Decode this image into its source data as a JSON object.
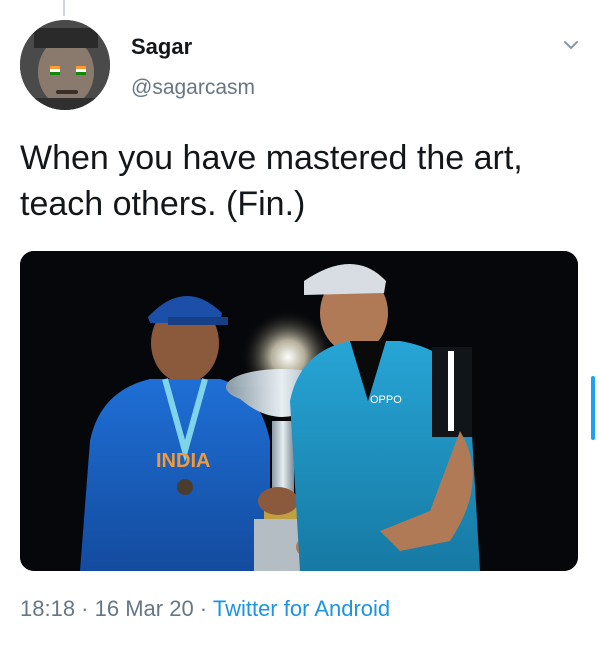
{
  "tweet": {
    "author_name": "Sagar",
    "author_handle": "@sagarcasm",
    "text_line1": "When you have mastered the art,",
    "text_line2": "teach others. (Fin.)",
    "time": "18:18",
    "date": "16 Mar 20",
    "separator": " · ",
    "source": "Twitter for Android"
  },
  "icons": {
    "menu": "chevron-down-icon",
    "avatar": "avatar-photo"
  },
  "media": {
    "description_visible_text": "INDIA",
    "sponsor_text": "OPPO"
  },
  "colors": {
    "link": "#1b95e0",
    "secondary_text": "#657786",
    "primary_text": "#14171a",
    "accent": "#1da1f2"
  }
}
